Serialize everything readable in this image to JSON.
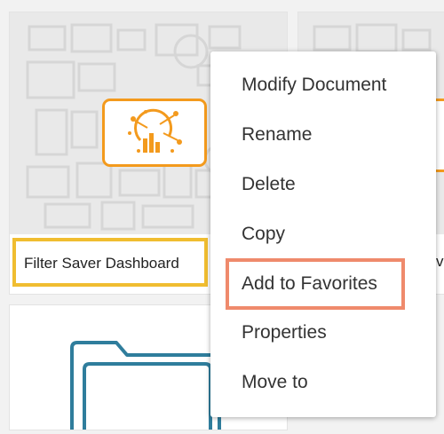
{
  "cards": [
    {
      "name": "Filter Saver Dashboard"
    },
    {
      "name": "v"
    }
  ],
  "context_menu": {
    "items": [
      {
        "label": "Modify Document"
      },
      {
        "label": "Rename"
      },
      {
        "label": "Delete"
      },
      {
        "label": "Copy"
      },
      {
        "label": "Add to Favorites"
      },
      {
        "label": "Properties"
      },
      {
        "label": "Move to"
      }
    ]
  },
  "colors": {
    "dashboard_icon": "#f39a1d",
    "selected_card_border": "#f0bd30",
    "menu_highlight": "#ef8a6c",
    "folder_icon": "#2f7d9c"
  },
  "icons": [
    "dashboard-icon",
    "folder-icon"
  ]
}
